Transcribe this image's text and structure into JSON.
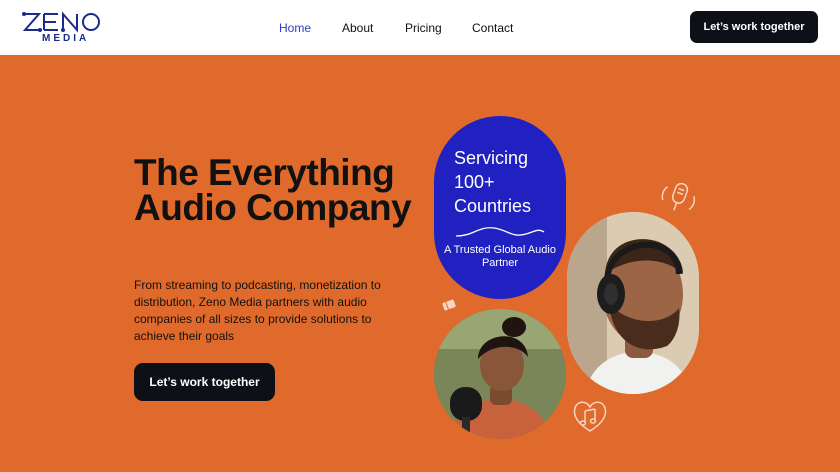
{
  "brand": {
    "wordmark": "ZENO",
    "submark": "MEDIA",
    "color": "#1c2a8a"
  },
  "nav": {
    "links": [
      {
        "label": "Home",
        "active": true
      },
      {
        "label": "About",
        "active": false
      },
      {
        "label": "Pricing",
        "active": false
      },
      {
        "label": "Contact",
        "active": false
      }
    ],
    "cta_label": "Let’s work together"
  },
  "hero": {
    "headline": "The Everything Audio Company",
    "subtext": "From streaming to podcasting, monetization to distribution, Zeno Media partners with audio companies of all sizes to provide solutions to achieve their goals",
    "cta_label": "Let’s work together",
    "background_color": "#e06a2b",
    "stat_pill": {
      "stat": "Servicing 100+ Countries",
      "caption": "A Trusted Global Audio Partner",
      "color": "#2021c0"
    },
    "decor_icons": [
      "microphone-icon",
      "music-heart-icon",
      "ticket-icon"
    ],
    "photos": [
      "man-with-headphones-photo",
      "woman-podcasting-photo"
    ]
  }
}
